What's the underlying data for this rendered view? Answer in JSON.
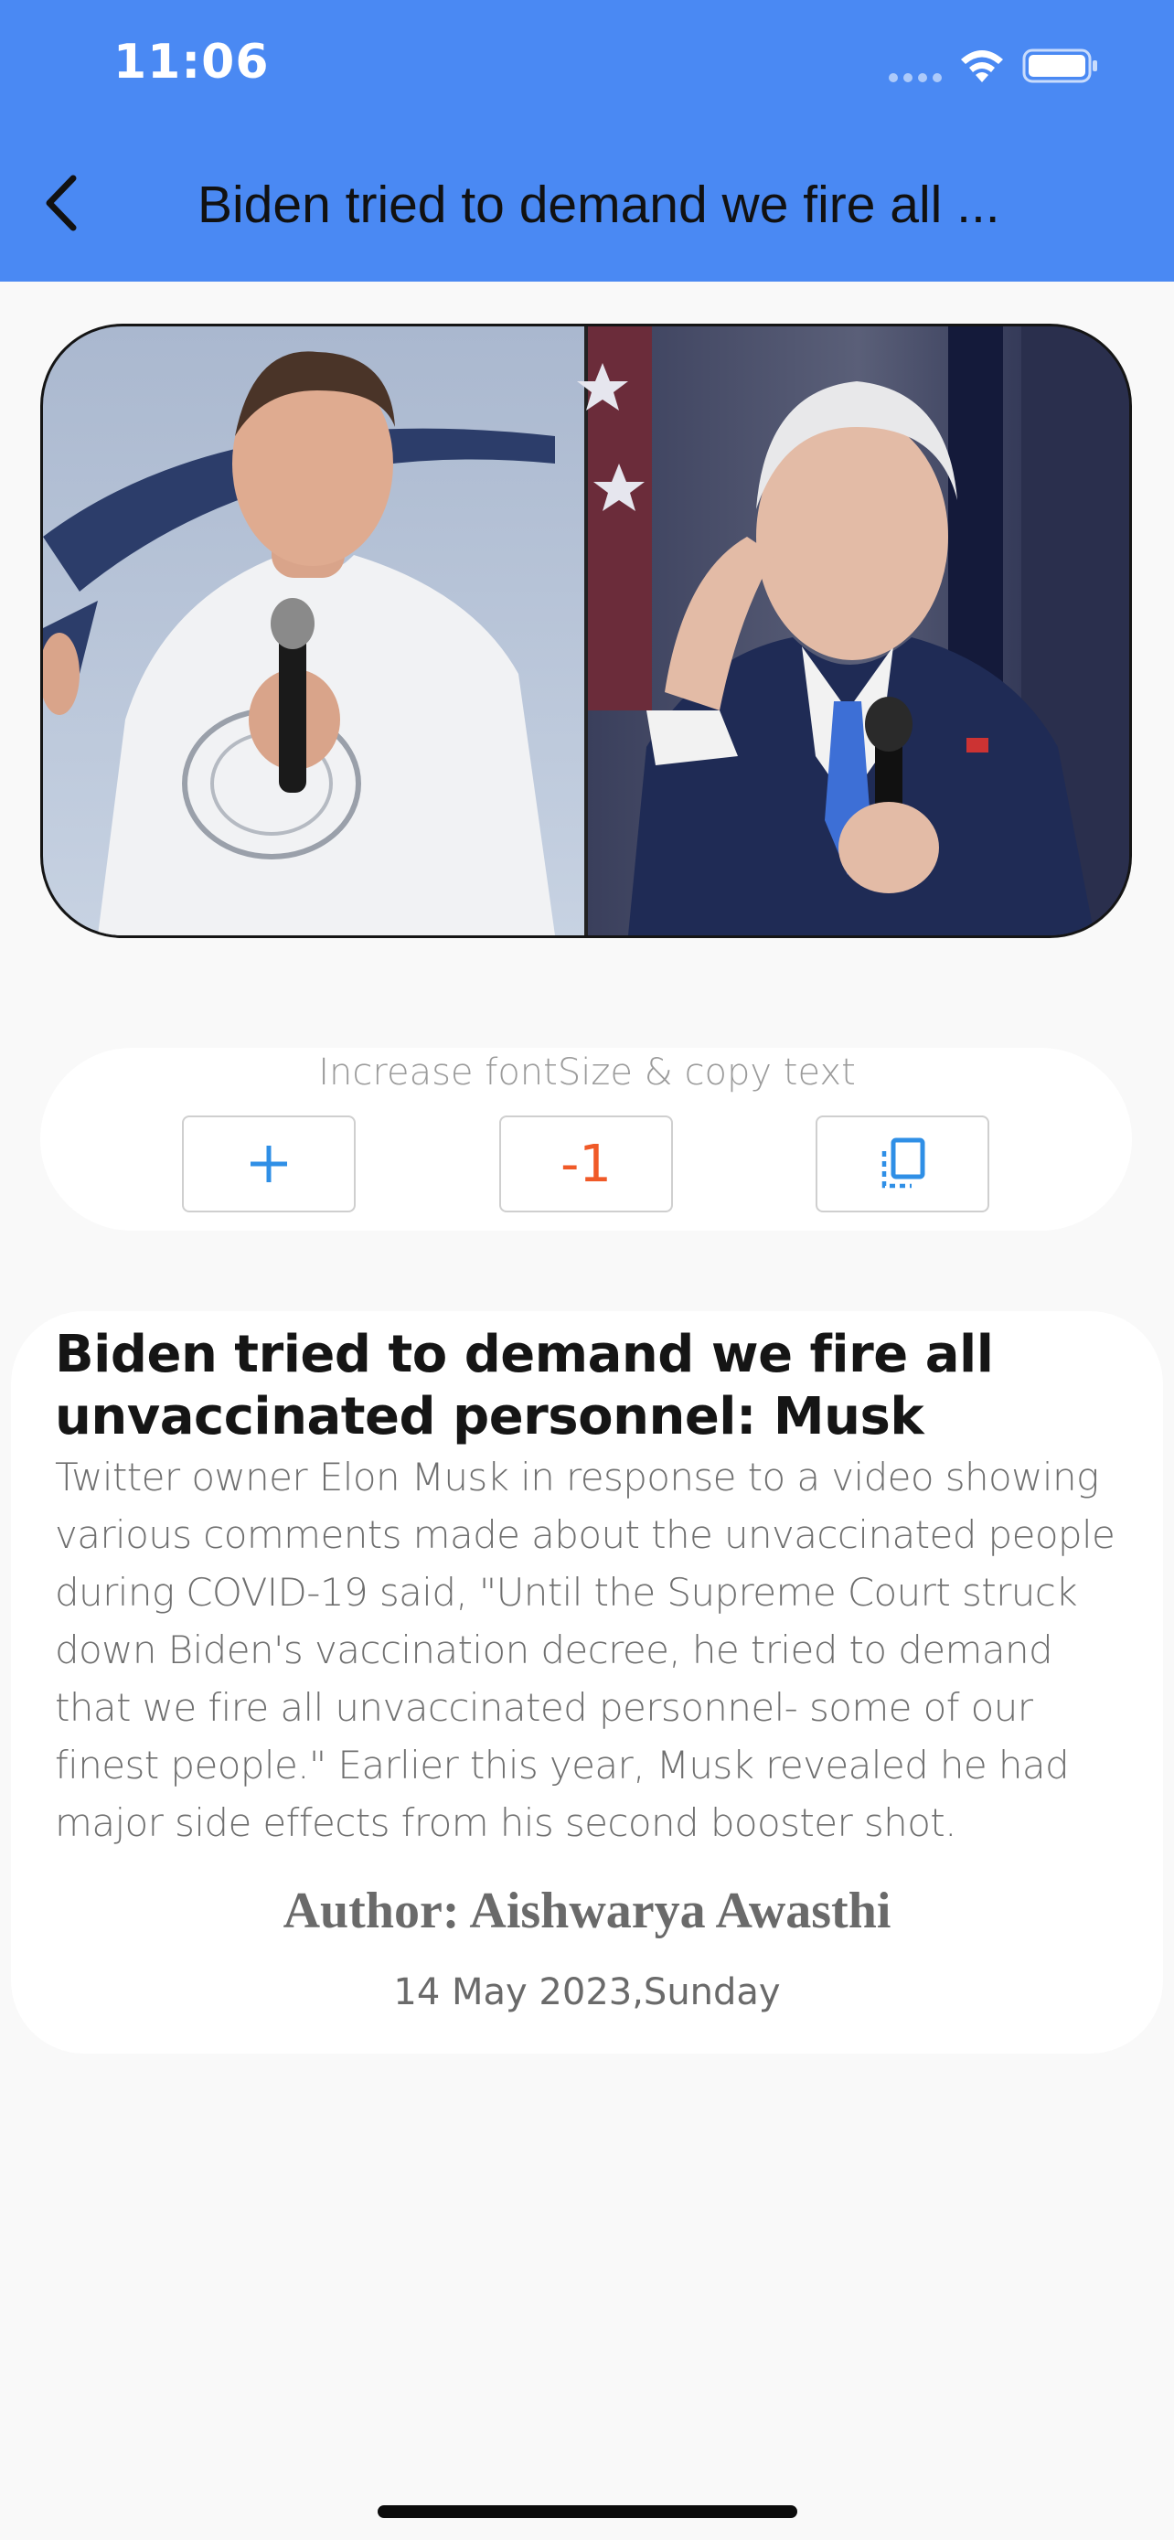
{
  "status_bar": {
    "time": "11:06",
    "icons": [
      "signal-icon",
      "wifi-icon",
      "battery-icon"
    ]
  },
  "header": {
    "back_icon": "chevron-left-icon",
    "title": "Biden tried to demand we fire all ...",
    "background_color": "#4a89f3"
  },
  "hero_image": {
    "description_icon": "news-photo"
  },
  "controls": {
    "caption": "Increase fontSize & copy text",
    "increase_icon": "plus-icon",
    "decrease_label": "-1",
    "copy_icon": "copy-icon",
    "increase_color": "#2f8fe6",
    "decrease_color": "#f05a28"
  },
  "article": {
    "title": "Biden tried to demand we fire all unvaccinated personnel: Musk",
    "body": "Twitter owner Elon Musk in response to a video showing various comments made about the unvaccinated people during COVID-19 said, \"Until the Supreme Court struck down Biden's vaccination decree, he tried to demand that we fire all unvaccinated personnel- some of our finest people.\" Earlier this year, Musk revealed he had major side effects from his second booster shot.",
    "author": "Author: Aishwarya Awasthi",
    "date": "14 May 2023,Sunday"
  }
}
